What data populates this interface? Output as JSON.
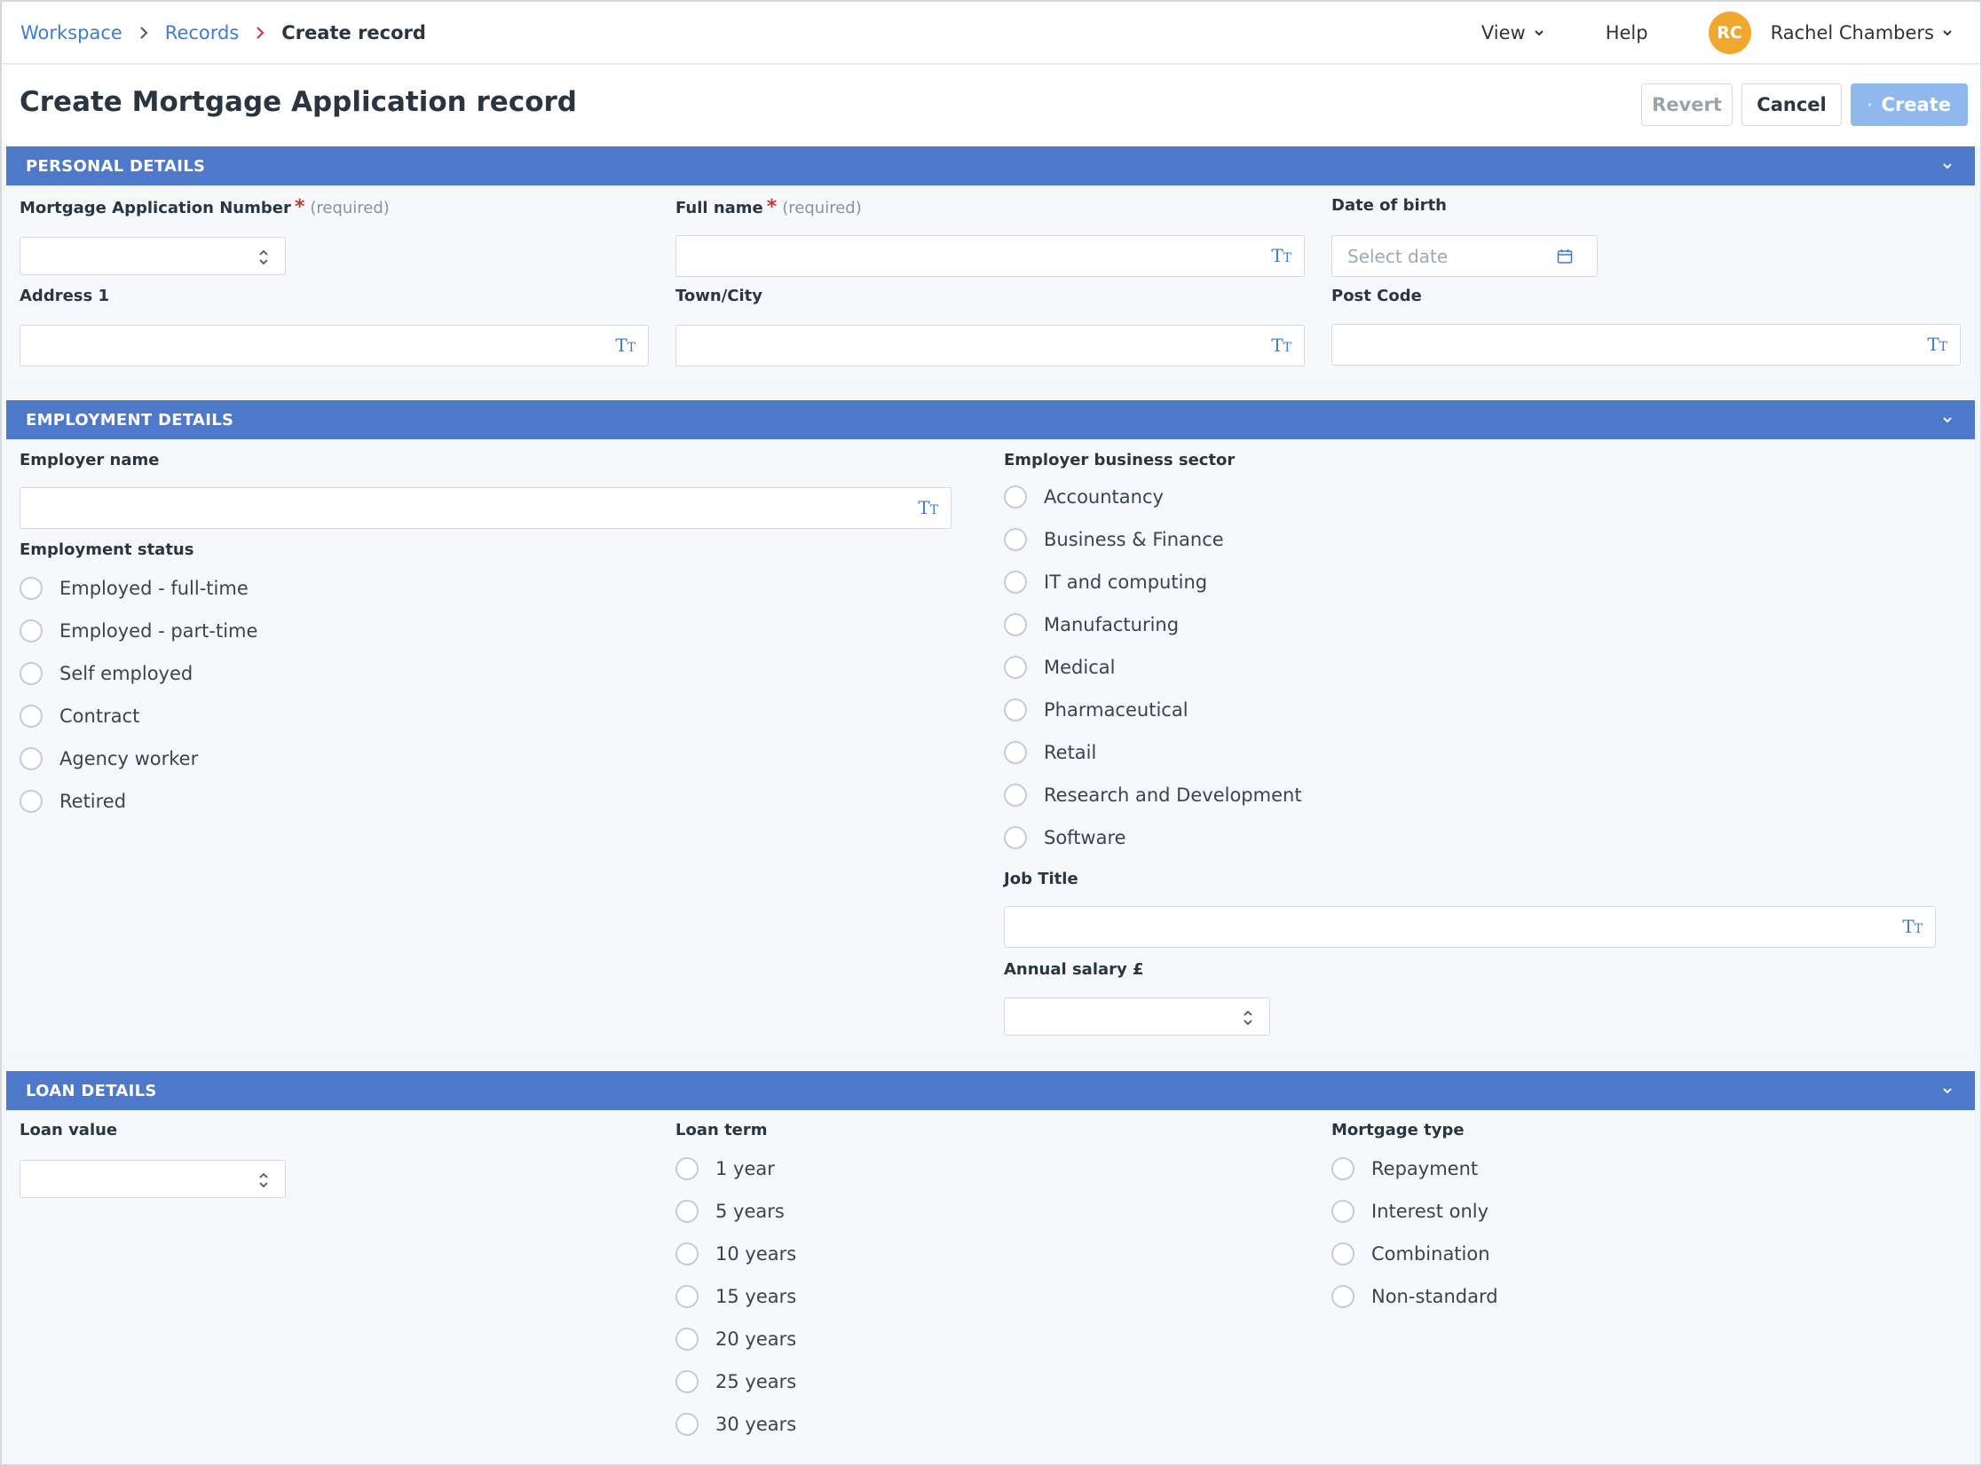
{
  "breadcrumb": {
    "items": [
      "Workspace",
      "Records"
    ],
    "current": "Create record"
  },
  "topnav": {
    "view": "View",
    "help": "Help",
    "user_initials": "RC",
    "user_name": "Rachel Chambers"
  },
  "page": {
    "title": "Create Mortgage Application record"
  },
  "actions": {
    "revert": "Revert",
    "cancel": "Cancel",
    "create": "Create"
  },
  "personal": {
    "heading": "PERSONAL DETAILS",
    "app_number_label": "Mortgage Application Number",
    "full_name_label": "Full name",
    "required_text": "(required)",
    "dob_label": "Date of birth",
    "dob_placeholder": "Select date",
    "address_label": "Address 1",
    "town_label": "Town/City",
    "postcode_label": "Post Code"
  },
  "employment": {
    "heading": "EMPLOYMENT DETAILS",
    "employer_label": "Employer name",
    "status_label": "Employment status",
    "status_options": [
      "Employed - full-time",
      "Employed - part-time",
      "Self employed",
      "Contract",
      "Agency worker",
      "Retired"
    ],
    "sector_label": "Employer business sector",
    "sector_options": [
      "Accountancy",
      "Business & Finance",
      "IT and computing",
      "Manufacturing",
      "Medical",
      "Pharmaceutical",
      "Retail",
      "Research and Development",
      "Software"
    ],
    "job_title_label": "Job Title",
    "salary_label": "Annual salary £"
  },
  "loan": {
    "heading": "LOAN DETAILS",
    "value_label": "Loan value",
    "term_label": "Loan term",
    "term_options": [
      "1 year",
      "5 years",
      "10 years",
      "15 years",
      "20 years",
      "25 years",
      "30 years"
    ],
    "type_label": "Mortgage type",
    "type_options": [
      "Repayment",
      "Interest only",
      "Combination",
      "Non-standard"
    ]
  },
  "icons": {
    "text_field": "text-type-icon",
    "stepper": "stepper-icon",
    "calendar": "calendar-icon",
    "collapse": "chevron-down-icon"
  },
  "colors": {
    "section_header": "#4e78c9",
    "link": "#3f7ccc",
    "avatar": "#f0a830",
    "create_button": "#8fb8ef",
    "required": "#c0392b"
  }
}
